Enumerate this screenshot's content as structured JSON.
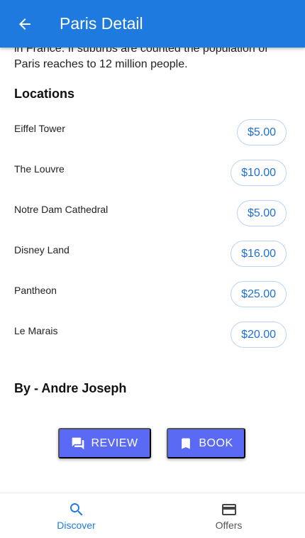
{
  "appbar": {
    "title": "Paris Detail",
    "back_icon": "arrow-back-icon",
    "color": "#1f7ae0"
  },
  "intro": {
    "text": "in France. If suburbs are counted the population of Paris reaches to 12 million people."
  },
  "locations": {
    "title": "Locations",
    "items": [
      {
        "name": "Eiffel Tower",
        "price": "$5.00"
      },
      {
        "name": "The Louvre",
        "price": "$10.00"
      },
      {
        "name": "Notre Dam Cathedral",
        "price": "$5.00"
      },
      {
        "name": "Disney Land",
        "price": "$16.00"
      },
      {
        "name": "Pantheon",
        "price": "$25.00"
      },
      {
        "name": "Le Marais",
        "price": "$20.00"
      }
    ]
  },
  "author": {
    "text": "By - Andre Joseph"
  },
  "actions": {
    "review_label": "REVIEW",
    "book_label": "BOOK",
    "review_icon": "comment-icon",
    "book_icon": "bookmark-icon",
    "button_color": "#5a6af5"
  },
  "bottom_nav": {
    "items": [
      {
        "label": "Discover",
        "icon": "search-icon",
        "active": true
      },
      {
        "label": "Offers",
        "icon": "credit-card-icon",
        "active": false
      }
    ],
    "active_color": "#1f7ae0"
  }
}
